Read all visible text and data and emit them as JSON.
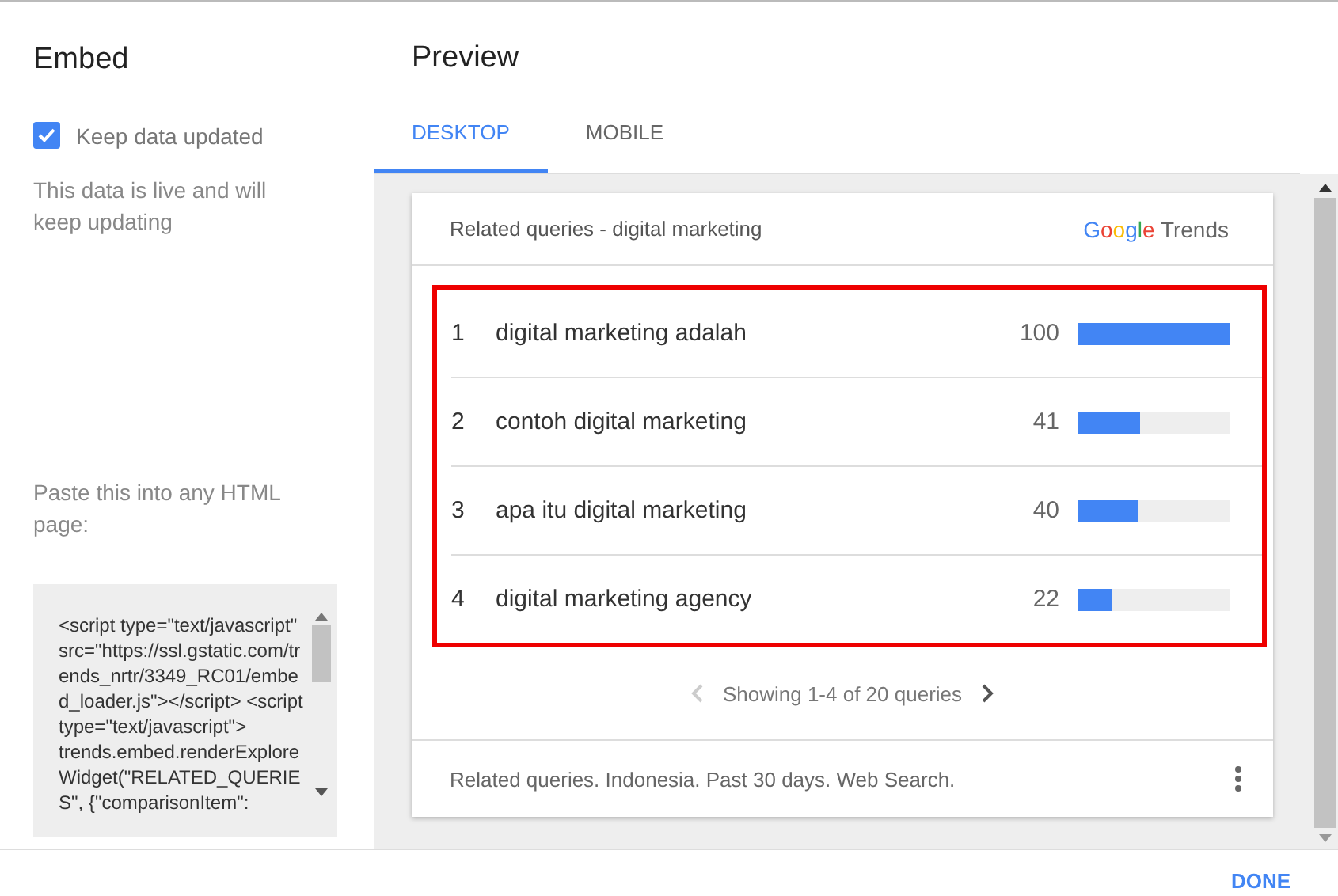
{
  "sidebar": {
    "title": "Embed",
    "keep_updated": {
      "label": "Keep data updated",
      "checked": true
    },
    "note": "This data is live and will keep updating",
    "paste_label": "Paste this into any HTML page:",
    "code": "<script type=\"text/javascript\" src=\"https://ssl.gstatic.com/trends_nrtr/3349_RC01/embed_loader.js\"></script> <script type=\"text/javascript\"> trends.embed.renderExploreWidget(\"RELATED_QUERIES\", {\"comparisonItem\":"
  },
  "preview": {
    "title": "Preview",
    "tabs": [
      {
        "label": "DESKTOP",
        "selected": true
      },
      {
        "label": "MOBILE",
        "selected": false
      }
    ]
  },
  "widget": {
    "title": "Related queries - digital marketing",
    "logo": {
      "brand": "Google",
      "product": "Trends"
    },
    "rows": [
      {
        "rank": "1",
        "query": "digital marketing adalah",
        "value": "100",
        "level": 1.0
      },
      {
        "rank": "2",
        "query": "contoh digital marketing",
        "value": "41",
        "level": 0.41
      },
      {
        "rank": "3",
        "query": "apa itu digital marketing",
        "value": "40",
        "level": 0.4
      },
      {
        "rank": "4",
        "query": "digital marketing agency",
        "value": "22",
        "level": 0.22
      }
    ],
    "pager": "Showing 1-4 of 20 queries",
    "footer": "Related queries. Indonesia. Past 30 days. Web Search."
  },
  "done_button": "DONE"
}
